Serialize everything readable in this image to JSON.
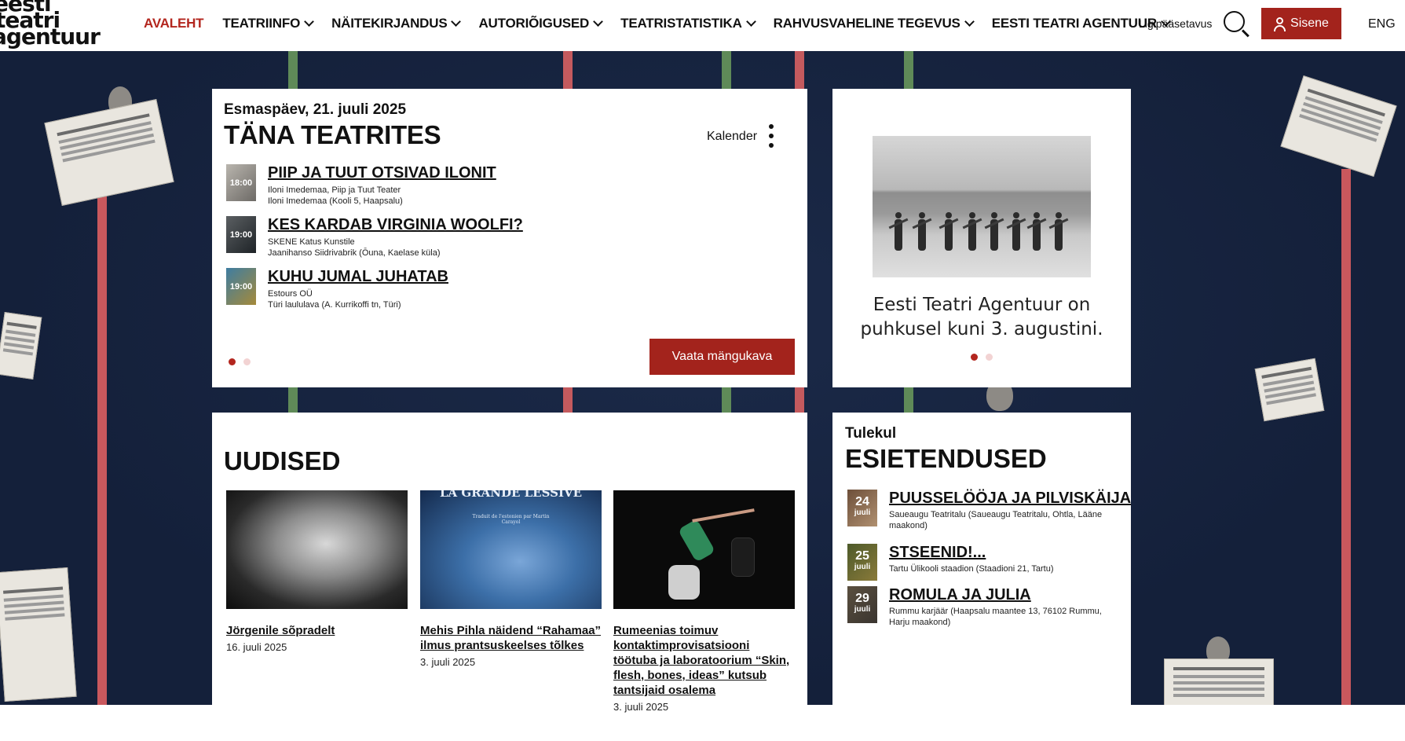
{
  "header": {
    "logo_lines": [
      "eesti",
      "teatri",
      "agentuur"
    ],
    "nav": [
      {
        "label": "AVALEHT",
        "active": true,
        "dropdown": false
      },
      {
        "label": "TEATRIINFO",
        "active": false,
        "dropdown": true
      },
      {
        "label": "NÄITEKIRJANDUS",
        "active": false,
        "dropdown": true
      },
      {
        "label": "AUTORIÕIGUSED",
        "active": false,
        "dropdown": true
      },
      {
        "label": "TEATRISTATISTIKA",
        "active": false,
        "dropdown": true
      },
      {
        "label": "RAHVUSVAHELINE TEGEVUS",
        "active": false,
        "dropdown": true
      },
      {
        "label": "EESTI TEATRI AGENTUUR",
        "active": false,
        "dropdown": true
      }
    ],
    "accessibility": "Ligipääsetavus",
    "search_icon": "search-icon",
    "login": "Sisene",
    "language": "ENG"
  },
  "colors": {
    "accent": "#a3231c",
    "active_nav": "#b3261e",
    "background": "#14203a"
  },
  "today": {
    "date": "Esmaspäev, 21. juuli 2025",
    "title": "TÄNA TEATRITES",
    "calendar_label": "Kalender",
    "shows": [
      {
        "time": "18:00",
        "title": "PIIP JA TUUT OTSIVAD ILONIT",
        "producer": "Iloni Imedemaa, Piip ja Tuut Teater",
        "venue": "Iloni Imedemaa (Kooli 5, Haapsalu)"
      },
      {
        "time": "19:00",
        "title": "KES KARDAB VIRGINIA WOOLFI?",
        "producer": "SKENE Katus Kunstile",
        "venue": "Jaanihanso Siidrivabrik (Ōuna, Kaelase küla)"
      },
      {
        "time": "19:00",
        "title": "KUHU JUMAL JUHATAB",
        "producer": "Estours OÜ",
        "venue": "Türi laululava (A. Kurrikoffi tn, Türi)"
      }
    ],
    "button": "Vaata mängukava"
  },
  "promo": {
    "text": "Eesti Teatri Agentuur on puhkusel kuni 3. augustini."
  },
  "news": {
    "title": "UUDISED",
    "items": [
      {
        "title": "Jörgenile sõpradelt",
        "date": "16. juuli 2025"
      },
      {
        "title": "Mehis Pihla näidend “Rahamaa” ilmus prantsuskeelses tõlkes",
        "date": "3. juuli 2025",
        "image_text": "LA GRANDE LESSIVE",
        "image_subtext": "Traduit de l'estonien par Martin Carayol"
      },
      {
        "title": "Rumeenias toimuv kontaktimprovisatsiooni töötuba ja laboratoorium “Skin, flesh, bones, ideas” kutsub tantsijaid osalema",
        "date": "3. juuli 2025"
      }
    ]
  },
  "premieres": {
    "upcoming": "Tulekul",
    "title": "ESIETENDUSED",
    "items": [
      {
        "day": "24",
        "month": "juuli",
        "title": "PUUSSELÖÖJA JA PILVISKÄIJA",
        "venue": "Saueaugu Teatritalu (Saueaugu Teatritalu, Ohtla, Lääne maakond)"
      },
      {
        "day": "25",
        "month": "juuli",
        "title": "STSEENID!...",
        "venue": "Tartu Ülikooli staadion (Staadioni 21, Tartu)"
      },
      {
        "day": "29",
        "month": "juuli",
        "title": "ROMULA JA JULIA",
        "venue": "Rummu karjäär (Haapsalu maantee 13, 76102 Rummu, Harju maakond)"
      }
    ]
  }
}
